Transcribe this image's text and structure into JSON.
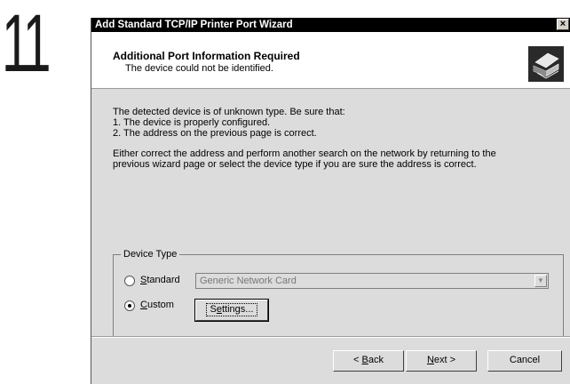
{
  "step": {
    "number": "11"
  },
  "window": {
    "title": "Add Standard TCP/IP Printer Port Wizard",
    "close_glyph": "×"
  },
  "header": {
    "title": "Additional Port Information Required",
    "subtitle": "The device could not be identified.",
    "icon": "printer-port-icon"
  },
  "body": {
    "intro": "The detected device is of unknown type.  Be sure that:",
    "point1": "1. The device is properly configured.",
    "point2": "2.  The address on the previous page is correct.",
    "para_line1": "Either correct the address and perform another search on the network by returning to the",
    "para_line2": "previous wizard page or select the device type if you are sure the address is correct."
  },
  "device_type": {
    "legend": "Device Type",
    "standard": {
      "accel": "S",
      "rest": "tandard",
      "selected": false
    },
    "standard_value": "Generic Network Card",
    "custom": {
      "accel": "C",
      "rest": "ustom",
      "selected": true
    },
    "settings": {
      "pre": "S",
      "accel": "e",
      "post": "ttings..."
    }
  },
  "buttons": {
    "back": {
      "pre": "< ",
      "accel": "B",
      "post": "ack"
    },
    "next": {
      "accel": "N",
      "post": "ext >"
    },
    "cancel": "Cancel"
  },
  "colors": {
    "titlebar": "#000000",
    "dialog": "#dcdcdc",
    "header": "#ffffff"
  }
}
